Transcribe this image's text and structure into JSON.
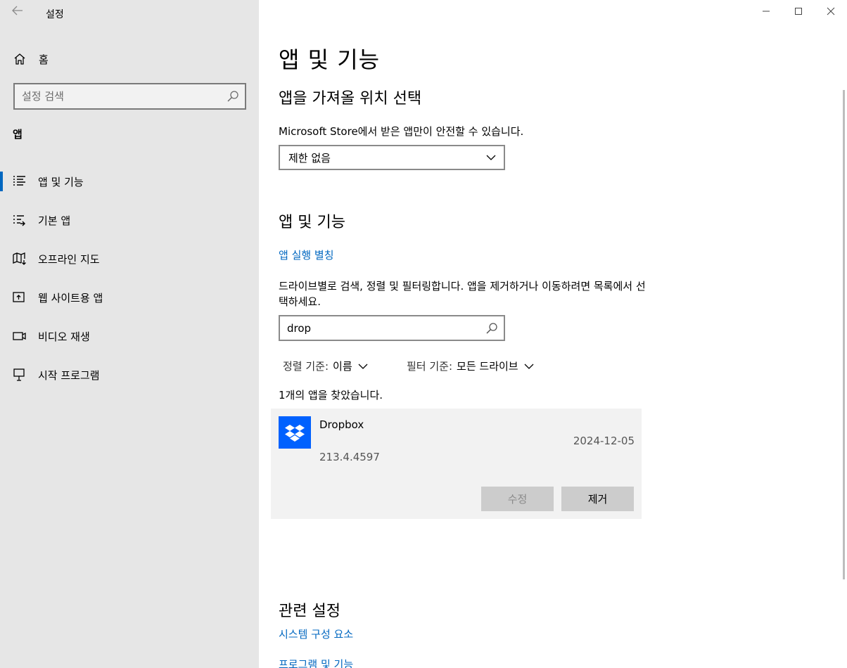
{
  "window": {
    "title": "설정",
    "controls": {
      "minimize": "minimize-icon",
      "maximize": "maximize-icon",
      "close": "close-icon"
    }
  },
  "sidebar": {
    "home_label": "홈",
    "search_placeholder": "설정 검색",
    "section": "앱",
    "items": [
      {
        "label": "앱 및 기능",
        "icon": "apps-features-icon",
        "active": true
      },
      {
        "label": "기본 앱",
        "icon": "default-apps-icon",
        "active": false
      },
      {
        "label": "오프라인 지도",
        "icon": "offline-maps-icon",
        "active": false
      },
      {
        "label": "웹 사이트용 앱",
        "icon": "apps-for-websites-icon",
        "active": false
      },
      {
        "label": "비디오 재생",
        "icon": "video-playback-icon",
        "active": false
      },
      {
        "label": "시작 프로그램",
        "icon": "startup-icon",
        "active": false
      }
    ]
  },
  "main": {
    "title": "앱 및 기능",
    "install_source": {
      "heading": "앱을 가져올 위치 선택",
      "description": "Microsoft Store에서 받은 앱만이 안전할 수 있습니다.",
      "selected": "제한 없음"
    },
    "apps": {
      "heading": "앱 및 기능",
      "aliases_link": "앱 실행 별칭",
      "description": "드라이브별로 검색, 정렬 및 필터링합니다. 앱을 제거하거나 이동하려면 목록에서 선택하세요.",
      "search_value": "drop",
      "sort_label": "정렬 기준:",
      "sort_value": "이름",
      "filter_label": "필터 기준:",
      "filter_value": "모든 드라이브",
      "result_count": "1개의 앱을 찾았습니다."
    },
    "app_item": {
      "name": "Dropbox",
      "date": "2024-12-05",
      "version": "213.4.4597",
      "modify_label": "수정",
      "remove_label": "제거"
    },
    "related": {
      "heading": "관련 설정",
      "links": [
        "시스템 구성 요소",
        "프로그램 및 기능"
      ]
    }
  },
  "colors": {
    "accent": "#0067c0",
    "sidebar_bg": "#e6e6e6",
    "dropbox_blue": "#0061fe"
  }
}
